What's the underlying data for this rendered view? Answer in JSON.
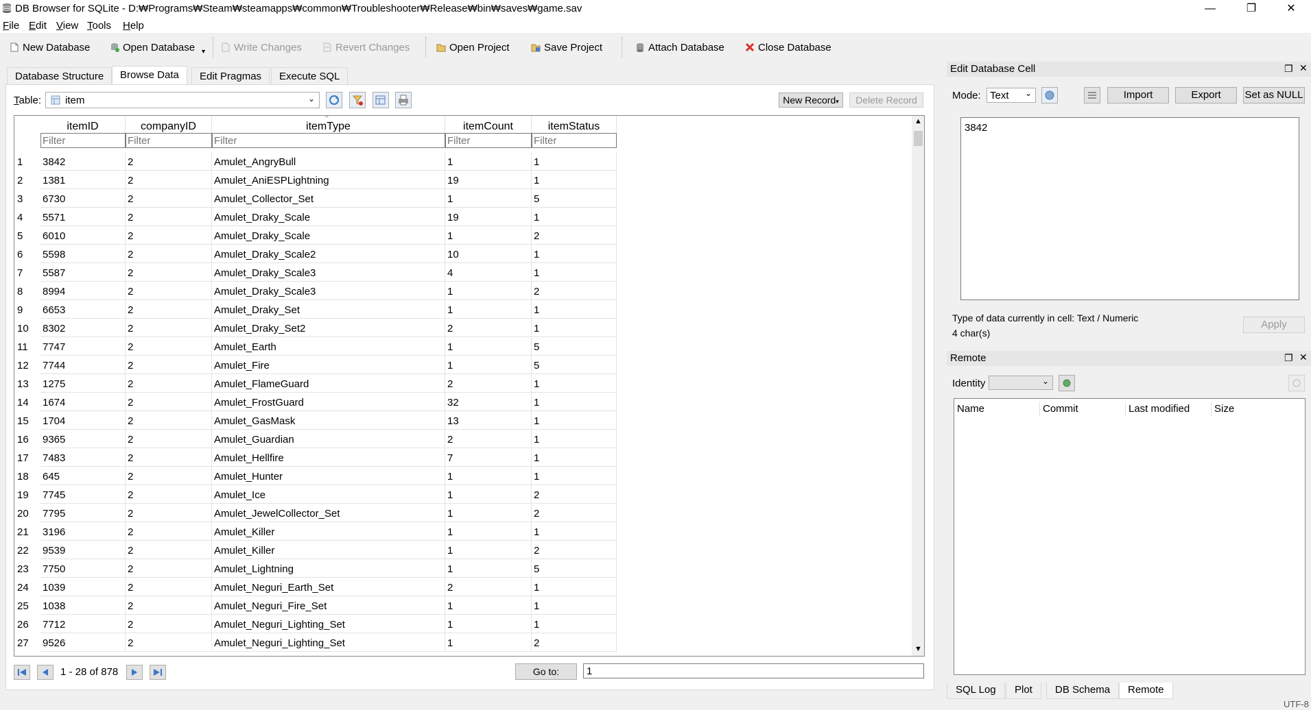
{
  "window": {
    "title": "DB Browser for SQLite - D:₩Programs₩Steam₩steamapps₩common₩Troubleshooter₩Release₩bin₩saves₩game.sav",
    "controls": {
      "minimize": "—",
      "restore": "❐",
      "close": "✕"
    }
  },
  "menu": [
    {
      "label": "File",
      "u": "F",
      "rest": "ile"
    },
    {
      "label": "Edit",
      "u": "E",
      "rest": "dit"
    },
    {
      "label": "View",
      "u": "V",
      "rest": "iew"
    },
    {
      "label": "Tools",
      "u": "T",
      "rest": "ools"
    },
    {
      "label": "Help",
      "u": "H",
      "rest": "elp"
    }
  ],
  "toolbar": {
    "new_database": "New Database",
    "open_database": "Open Database",
    "write_changes": "Write Changes",
    "revert_changes": "Revert Changes",
    "open_project": "Open Project",
    "save_project": "Save Project",
    "attach_database": "Attach Database",
    "close_database": "Close Database"
  },
  "tabs": [
    "Database Structure",
    "Browse Data",
    "Edit Pragmas",
    "Execute SQL"
  ],
  "browse": {
    "table_label": "Table:",
    "table_label_u": "T",
    "table_label_rest": "able:",
    "table_value": "item",
    "new_record": "New Record",
    "delete_record": "Delete Record",
    "filter_placeholder": "Filter",
    "columns": [
      "itemID",
      "companyID",
      "itemType",
      "itemCount",
      "itemStatus"
    ],
    "rows": [
      [
        "1",
        "3842",
        "2",
        "Amulet_AngryBull",
        "1",
        "1"
      ],
      [
        "2",
        "1381",
        "2",
        "Amulet_AniESPLightning",
        "19",
        "1"
      ],
      [
        "3",
        "6730",
        "2",
        "Amulet_Collector_Set",
        "1",
        "5"
      ],
      [
        "4",
        "5571",
        "2",
        "Amulet_Draky_Scale",
        "19",
        "1"
      ],
      [
        "5",
        "6010",
        "2",
        "Amulet_Draky_Scale",
        "1",
        "2"
      ],
      [
        "6",
        "5598",
        "2",
        "Amulet_Draky_Scale2",
        "10",
        "1"
      ],
      [
        "7",
        "5587",
        "2",
        "Amulet_Draky_Scale3",
        "4",
        "1"
      ],
      [
        "8",
        "8994",
        "2",
        "Amulet_Draky_Scale3",
        "1",
        "2"
      ],
      [
        "9",
        "6653",
        "2",
        "Amulet_Draky_Set",
        "1",
        "1"
      ],
      [
        "10",
        "8302",
        "2",
        "Amulet_Draky_Set2",
        "2",
        "1"
      ],
      [
        "11",
        "7747",
        "2",
        "Amulet_Earth",
        "1",
        "5"
      ],
      [
        "12",
        "7744",
        "2",
        "Amulet_Fire",
        "1",
        "5"
      ],
      [
        "13",
        "1275",
        "2",
        "Amulet_FlameGuard",
        "2",
        "1"
      ],
      [
        "14",
        "1674",
        "2",
        "Amulet_FrostGuard",
        "32",
        "1"
      ],
      [
        "15",
        "1704",
        "2",
        "Amulet_GasMask",
        "13",
        "1"
      ],
      [
        "16",
        "9365",
        "2",
        "Amulet_Guardian",
        "2",
        "1"
      ],
      [
        "17",
        "7483",
        "2",
        "Amulet_Hellfire",
        "7",
        "1"
      ],
      [
        "18",
        "645",
        "2",
        "Amulet_Hunter",
        "1",
        "1"
      ],
      [
        "19",
        "7745",
        "2",
        "Amulet_Ice",
        "1",
        "2"
      ],
      [
        "20",
        "7795",
        "2",
        "Amulet_JewelCollector_Set",
        "1",
        "2"
      ],
      [
        "21",
        "3196",
        "2",
        "Amulet_Killer",
        "1",
        "1"
      ],
      [
        "22",
        "9539",
        "2",
        "Amulet_Killer",
        "1",
        "2"
      ],
      [
        "23",
        "7750",
        "2",
        "Amulet_Lightning",
        "1",
        "5"
      ],
      [
        "24",
        "1039",
        "2",
        "Amulet_Neguri_Earth_Set",
        "2",
        "1"
      ],
      [
        "25",
        "1038",
        "2",
        "Amulet_Neguri_Fire_Set",
        "1",
        "1"
      ],
      [
        "26",
        "7712",
        "2",
        "Amulet_Neguri_Lighting_Set",
        "1",
        "1"
      ],
      [
        "27",
        "9526",
        "2",
        "Amulet_Neguri_Lighting_Set",
        "1",
        "2"
      ]
    ],
    "record_range": "1 - 28 of 878",
    "goto_label": "Go to:",
    "goto_value": "1"
  },
  "edit_cell": {
    "title": "Edit Database Cell",
    "mode_label": "Mode:",
    "mode_value": "Text",
    "import": "Import",
    "export": "Export",
    "set_null": "Set as NULL",
    "content": "3842",
    "type_info": "Type of data currently in cell: Text / Numeric",
    "size_info": "4 char(s)",
    "apply": "Apply"
  },
  "remote": {
    "title": "Remote",
    "identity_label": "Identity",
    "columns": [
      "Name",
      "Commit",
      "Last modified",
      "Size"
    ]
  },
  "bottom_tabs": [
    "SQL Log",
    "Plot",
    "DB Schema",
    "Remote"
  ],
  "status": "UTF-8",
  "colors": {
    "accent": "#0078d7",
    "disabled": "#999999",
    "close_red": "#d9302a"
  }
}
